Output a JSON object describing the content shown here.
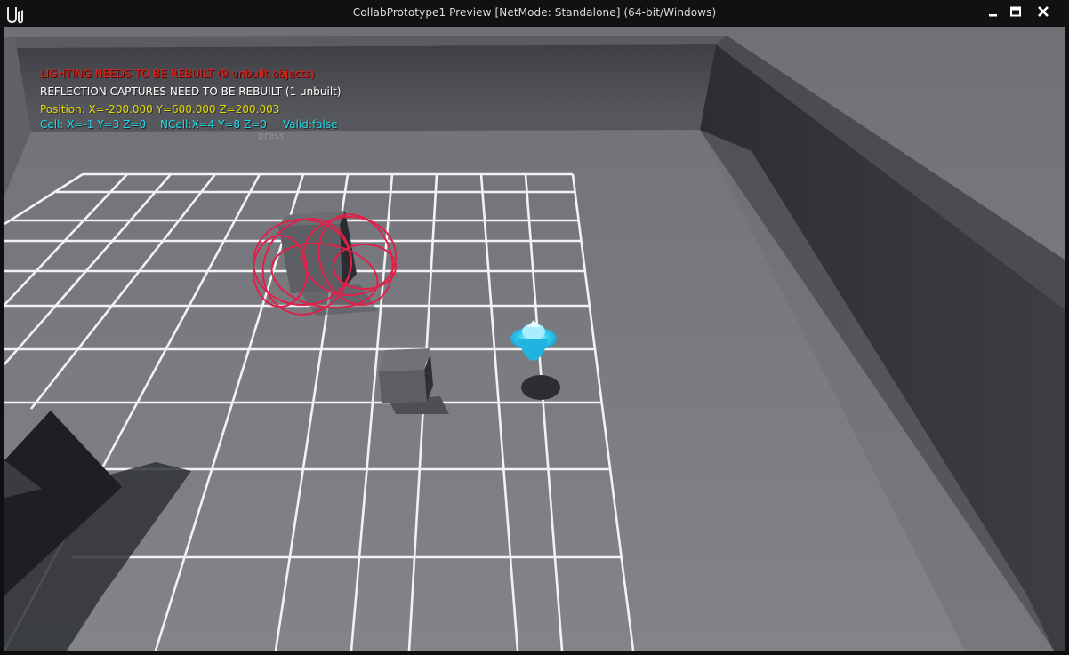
{
  "window": {
    "title": "CollabPrototype1 Preview [NetMode: Standalone]  (64-bit/Windows)",
    "controls": {
      "minimize": "minimize",
      "maximize": "maximize",
      "close": "close"
    }
  },
  "hud": {
    "lighting_warning": "LIGHTING NEEDS TO BE REBUILT (9 unbuilt objects)",
    "reflection_warning": "REFLECTION CAPTURES NEED TO BE REBUILT (1 unbuilt)",
    "position": "Position: X=-200.000 Y=600.000 Z=200.003",
    "cell": "Cell: X=-1 Y=3 Z=0",
    "ncell": "NCell:X=4 Y=8 Z=0",
    "valid": "Valid:false",
    "ghost_text": "press"
  },
  "colors": {
    "title_bar": "#111111",
    "hud_warning": "#e2231a",
    "hud_position": "#e6d800",
    "hud_cell": "#20d8e8",
    "floor": "#7a7c80",
    "grid": "#ffffff",
    "debug_spheres": "#e0204a",
    "pickup": "#29c8f0",
    "sky": "#b9d3ea"
  },
  "icons": [
    "unreal-engine-logo-icon",
    "minimize-icon",
    "maximize-icon",
    "close-icon"
  ]
}
